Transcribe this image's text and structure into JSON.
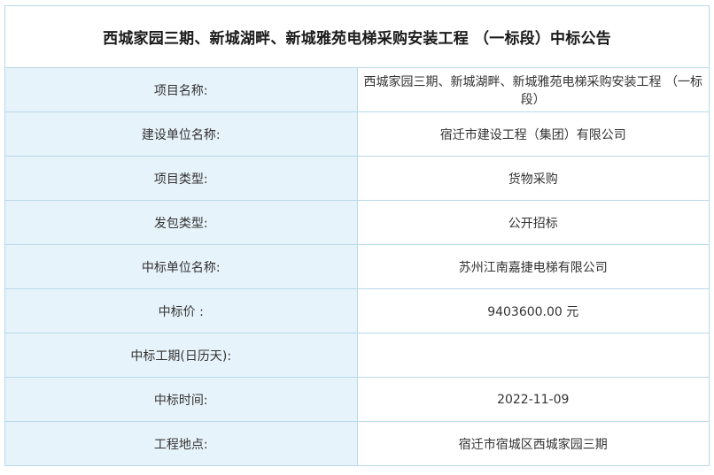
{
  "title": "西城家园三期、新城湖畔、新城雅苑电梯采购安装工程 （一标段）中标公告",
  "rows": [
    {
      "label": "项目名称:",
      "value": "西城家园三期、新城湖畔、新城雅苑电梯采购安装工程 （一标段）"
    },
    {
      "label": "建设单位名称:",
      "value": "宿迁市建设工程（集团）有限公司"
    },
    {
      "label": "项目类型:",
      "value": "货物采购"
    },
    {
      "label": "发包类型:",
      "value": "公开招标"
    },
    {
      "label": "中标单位名称:",
      "value": "苏州江南嘉捷电梯有限公司"
    },
    {
      "label": "中标价 :",
      "value": "9403600.00 元"
    },
    {
      "label": "中标工期(日历天):",
      "value": ""
    },
    {
      "label": "中标时间:",
      "value": "2022-11-09"
    },
    {
      "label": "工程地点:",
      "value": "宿迁市宿城区西城家园三期"
    }
  ]
}
